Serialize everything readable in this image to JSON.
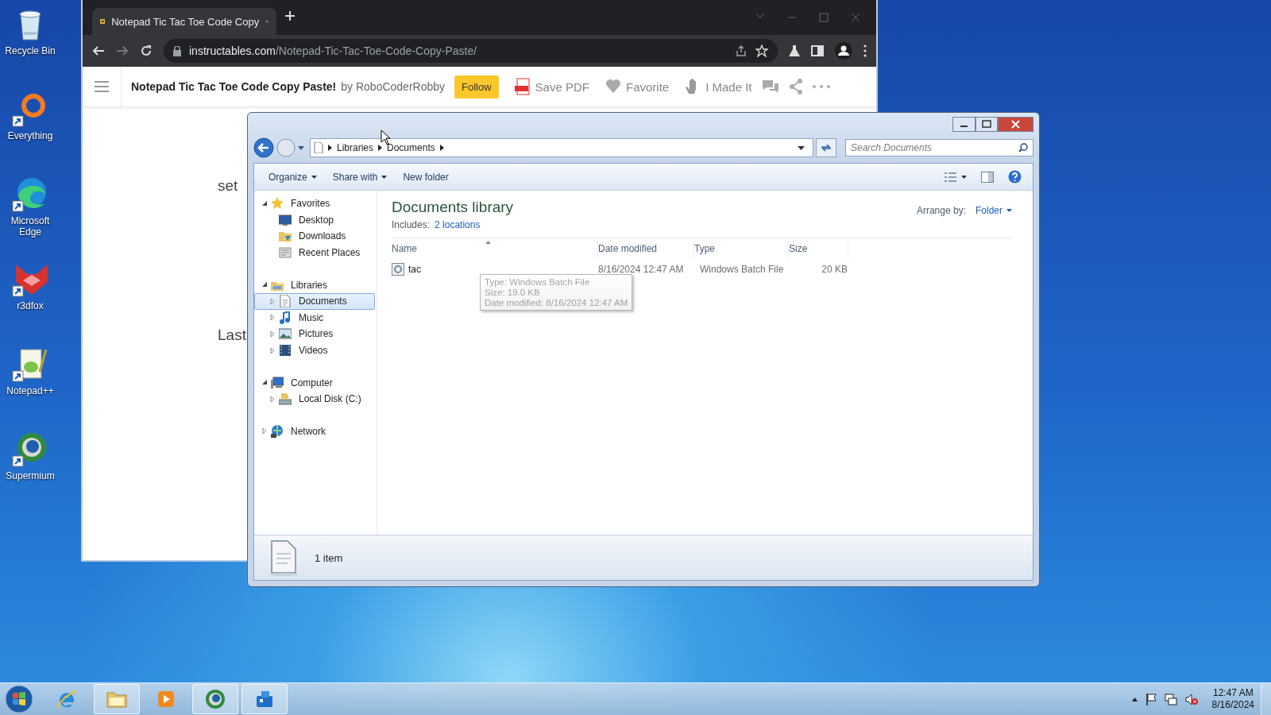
{
  "desktop_icons": [
    {
      "label": "Recycle Bin",
      "kind": "bin"
    },
    {
      "label": "Everything",
      "kind": "ring"
    },
    {
      "label": "Microsoft Edge",
      "kind": "wave"
    },
    {
      "label": "r3dfox",
      "kind": "fox"
    },
    {
      "label": "Notepad++",
      "kind": "notepad"
    },
    {
      "label": "Supermium",
      "kind": "orb"
    }
  ],
  "browser": {
    "tab_title": "Notepad Tic Tac Toe Code Copy",
    "address_host": "instructables.com",
    "address_path": "/Notepad-Tic-Tac-Toe-Code-Copy-Paste/",
    "article_title": "Notepad Tic Tac Toe Code Copy Paste!",
    "byline": "by RoboCoderRobby",
    "follow": "Follow",
    "actions": [
      {
        "label": "Save PDF",
        "kind": "pdf"
      },
      {
        "label": "Favorite",
        "kind": "heart"
      },
      {
        "label": "I Made It",
        "kind": "hand"
      }
    ],
    "body_text": [
      "set",
      "Last"
    ]
  },
  "explorer": {
    "breadcrumb": [
      "Libraries",
      "Documents"
    ],
    "search_placeholder": "Search Documents",
    "toolbar": [
      {
        "label": "Organize",
        "has_menu": true
      },
      {
        "label": "Share with",
        "has_menu": true
      },
      {
        "label": "New folder",
        "has_menu": false
      }
    ],
    "nav": [
      {
        "label": "Favorites",
        "kind": "star",
        "expandable": true,
        "expanded": true,
        "selected": false,
        "children": [
          {
            "label": "Desktop",
            "kind": "monitor",
            "expandable": false,
            "expanded": false,
            "selected": false
          },
          {
            "label": "Downloads",
            "kind": "folder",
            "expandable": false,
            "expanded": false,
            "selected": false
          },
          {
            "label": "Recent Places",
            "kind": "recent",
            "expandable": false,
            "expanded": false,
            "selected": false
          }
        ]
      },
      {
        "label": "Libraries",
        "kind": "library",
        "expandable": true,
        "expanded": true,
        "selected": false,
        "children": [
          {
            "label": "Documents",
            "kind": "document",
            "expandable": true,
            "expanded": false,
            "selected": true
          },
          {
            "label": "Music",
            "kind": "music",
            "expandable": true,
            "expanded": false,
            "selected": false
          },
          {
            "label": "Pictures",
            "kind": "picture",
            "expandable": true,
            "expanded": false,
            "selected": false
          },
          {
            "label": "Videos",
            "kind": "video",
            "expandable": true,
            "expanded": false,
            "selected": false
          }
        ]
      },
      {
        "label": "Computer",
        "kind": "computer",
        "expandable": true,
        "expanded": true,
        "selected": false,
        "children": [
          {
            "label": "Local Disk (C:)",
            "kind": "disk",
            "expandable": true,
            "expanded": false,
            "selected": false
          }
        ]
      },
      {
        "label": "Network",
        "kind": "network",
        "expandable": true,
        "expanded": false,
        "selected": false
      }
    ],
    "library": {
      "title": "Documents library",
      "includes_label": "Includes:",
      "includes_link": "2 locations",
      "arrange_label": "Arrange by:",
      "arrange_value": "Folder"
    },
    "columns": [
      "Name",
      "Date modified",
      "Type",
      "Size"
    ],
    "rows": [
      {
        "name": "tac",
        "date_modified": "8/16/2024 12:47 AM",
        "type": "Windows Batch File",
        "size": "20 KB",
        "selected": false
      }
    ],
    "tooltip": [
      "Type: Windows Batch File",
      "Size: 19.0 KB",
      "Date modified: 8/16/2024 12:47 AM"
    ],
    "status": "1 item"
  },
  "taskbar": {
    "apps": [
      {
        "kind": "ie",
        "open": false
      },
      {
        "kind": "folder",
        "open": true
      },
      {
        "kind": "media",
        "open": false
      },
      {
        "kind": "orb",
        "open": true
      },
      {
        "kind": "app",
        "open": true
      }
    ],
    "time": "12:47 AM",
    "date": "8/16/2024"
  }
}
